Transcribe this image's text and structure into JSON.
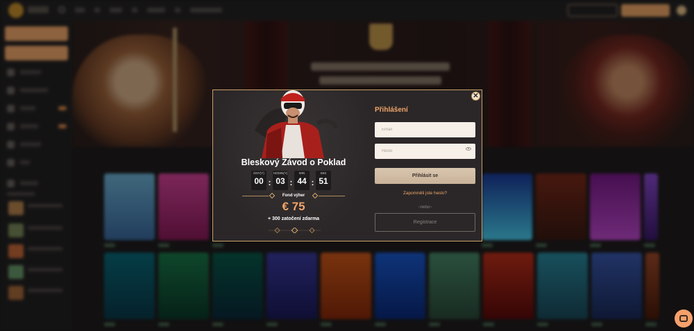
{
  "promo": {
    "title": "Bleskový Závod o Poklad",
    "timer": [
      {
        "label": "DNY(Y)",
        "value": "00"
      },
      {
        "label": "HODIN(Y)",
        "value": "03"
      },
      {
        "label": "MIN",
        "value": "44"
      },
      {
        "label": "SEK",
        "value": "51"
      }
    ],
    "fund_label": "Fond výher",
    "prize": "€ 75",
    "spins": "+ 300 zatočení zdarma"
  },
  "login": {
    "title": "Přihlášení",
    "email_placeholder": "Email",
    "password_placeholder": "Heslo",
    "submit_label": "Přihlásit se",
    "forgot_label": "Zapomněli jste heslo?",
    "or_label": "~nebo~",
    "register_label": "Registrace"
  },
  "close_symbol": "✕",
  "colors": {
    "accent": "#f0a56a",
    "modal_bg": "#2b2728",
    "modal_border": "#c9a067"
  },
  "icons": [
    "close-icon",
    "eye-icon",
    "chat-icon",
    "search-icon",
    "gear-icon"
  ]
}
